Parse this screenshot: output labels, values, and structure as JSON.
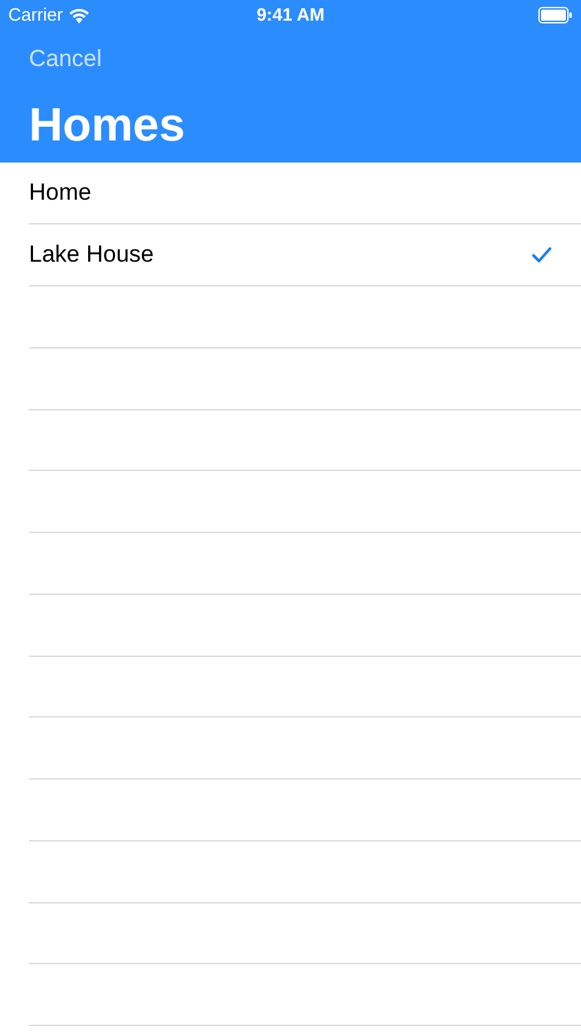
{
  "status_bar": {
    "carrier": "Carrier",
    "time": "9:41 AM"
  },
  "nav": {
    "back": "Cancel",
    "title": "Homes"
  },
  "homes": [
    {
      "label": "Home",
      "selected": false
    },
    {
      "label": "Lake House",
      "selected": true
    }
  ]
}
